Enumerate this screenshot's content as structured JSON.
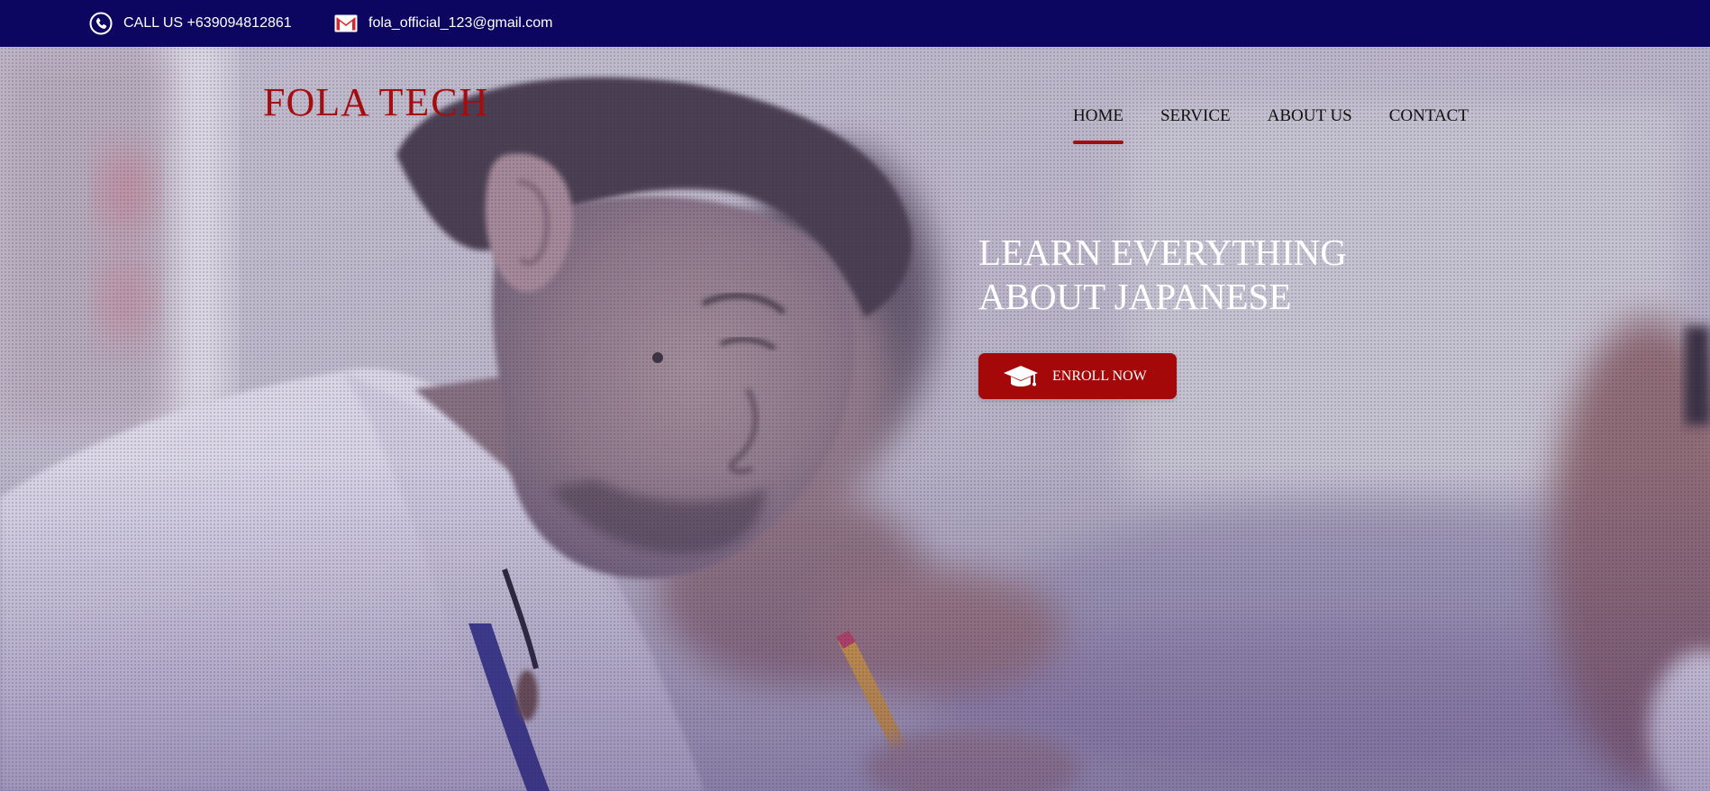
{
  "topbar": {
    "phone_text": "CALL US +639094812861",
    "email_text": "fola_official_123@gmail.com",
    "phone_icon": "phone-icon",
    "email_icon": "mail-icon"
  },
  "header": {
    "logo_first": "FOLA",
    "logo_second": "TECH",
    "nav": [
      {
        "label": "HOME",
        "active": true
      },
      {
        "label": "SERVICE",
        "active": false
      },
      {
        "label": "ABOUT US",
        "active": false
      },
      {
        "label": "CONTACT",
        "active": false
      }
    ]
  },
  "hero": {
    "headline_line1": "LEARN EVERYTHING",
    "headline_line2": "ABOUT JAPANESE",
    "cta_label": "ENROLL NOW",
    "cta_icon": "graduation-cap-icon"
  },
  "colors": {
    "topbar_bg": "#0c0660",
    "brand_red": "#a30d10",
    "cta_bg": "#a40808"
  }
}
